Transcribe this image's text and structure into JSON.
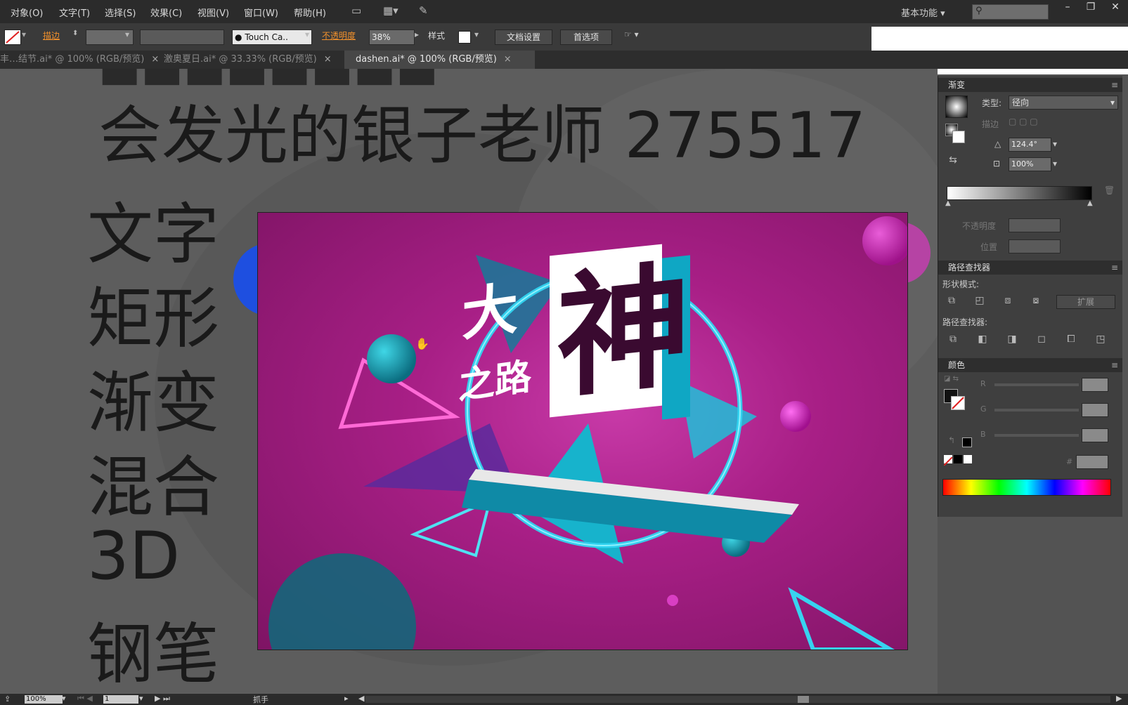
{
  "menubar": {
    "items": [
      "对象(O)",
      "文字(T)",
      "选择(S)",
      "效果(C)",
      "视图(V)",
      "窗口(W)",
      "帮助(H)"
    ],
    "workspace": "基本功能"
  },
  "controlbar": {
    "stroke_label": "描边",
    "font_name": "Touch Ca..",
    "opacity_label": "不透明度",
    "opacity_value": "38%",
    "style_label": "样式",
    "doc_setup": "文档设置",
    "prefs": "首选项"
  },
  "tabs": [
    {
      "label": "丰…结节.ai* @ 100% (RGB/预览)"
    },
    {
      "label": "激奥夏日.ai* @ 33.33% (RGB/预览)"
    },
    {
      "label": "dashen.ai* @ 100% (RGB/预览)"
    }
  ],
  "overlay_text": {
    "headline": "会发光的银子老师 275517",
    "words": [
      "文字",
      "矩形",
      "渐变",
      "混合",
      "3D",
      "钢笔"
    ]
  },
  "artwork": {
    "title_big": "神",
    "title_small_1": "大",
    "title_small_2": "之路"
  },
  "gradient_panel": {
    "title": "渐变",
    "type_label": "类型:",
    "type_value": "径向",
    "stroke_label": "描边",
    "angle_value": "124.4°",
    "aspect_value": "100%",
    "opacity_label": "不透明度",
    "location_label": "位置"
  },
  "pathfinder_panel": {
    "title": "路径查找器",
    "shape_modes": "形状模式:",
    "expand": "扩展",
    "pathfinders": "路径查找器:"
  },
  "color_panel": {
    "title": "颜色",
    "r": "R",
    "g": "G",
    "b": "B",
    "hash": "#"
  },
  "statusbar": {
    "zoom": "100%",
    "page": "1",
    "tool": "抓手"
  },
  "colors": {
    "artboard_magenta": "#a81f86",
    "teal": "#17b3cc",
    "menubar": "#2b2b2b"
  }
}
